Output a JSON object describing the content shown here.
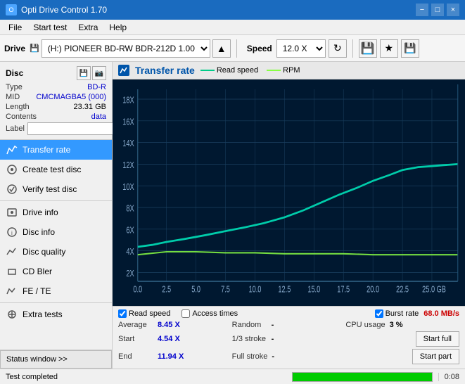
{
  "titleBar": {
    "title": "Opti Drive Control 1.70",
    "minimize": "−",
    "maximize": "□",
    "close": "×"
  },
  "menuBar": {
    "items": [
      "File",
      "Start test",
      "Extra",
      "Help"
    ]
  },
  "toolbar": {
    "driveLabel": "Drive",
    "driveValue": "(H:)  PIONEER BD-RW   BDR-212D 1.00",
    "speedLabel": "Speed",
    "speedValue": "12.0 X"
  },
  "disc": {
    "title": "Disc",
    "typeLabel": "Type",
    "typeValue": "BD-R",
    "midLabel": "MID",
    "midValue": "CMCMAGBA5 (000)",
    "lengthLabel": "Length",
    "lengthValue": "23.31 GB",
    "contentsLabel": "Contents",
    "contentsValue": "data",
    "labelLabel": "Label",
    "labelValue": ""
  },
  "nav": {
    "items": [
      {
        "id": "transfer-rate",
        "label": "Transfer rate",
        "active": true
      },
      {
        "id": "create-test-disc",
        "label": "Create test disc",
        "active": false
      },
      {
        "id": "verify-test-disc",
        "label": "Verify test disc",
        "active": false
      },
      {
        "id": "drive-info",
        "label": "Drive info",
        "active": false
      },
      {
        "id": "disc-info",
        "label": "Disc info",
        "active": false
      },
      {
        "id": "disc-quality",
        "label": "Disc quality",
        "active": false
      },
      {
        "id": "cd-bler",
        "label": "CD Bler",
        "active": false
      },
      {
        "id": "fe-te",
        "label": "FE / TE",
        "active": false
      },
      {
        "id": "extra-tests",
        "label": "Extra tests",
        "active": false
      }
    ]
  },
  "statusWindow": {
    "label": "Status window >>"
  },
  "chart": {
    "title": "Transfer rate",
    "legendReadSpeed": "Read speed",
    "legendRPM": "RPM",
    "readSpeedColor": "#00cc88",
    "rpmColor": "#88ff44",
    "yAxisLabels": [
      "2X",
      "4X",
      "6X",
      "8X",
      "10X",
      "12X",
      "14X",
      "16X",
      "18X"
    ],
    "xAxisLabels": [
      "0.0",
      "2.5",
      "5.0",
      "7.5",
      "10.0",
      "12.5",
      "15.0",
      "17.5",
      "20.0",
      "22.5",
      "25.0 GB"
    ]
  },
  "stats": {
    "readSpeedChecked": true,
    "accessTimesChecked": false,
    "burstRateChecked": true,
    "burstRateValue": "68.0 MB/s",
    "rows": [
      {
        "col1Label": "Average",
        "col1Value": "8.45 X",
        "col2Label": "Random",
        "col2Value": "-",
        "col3Label": "CPU usage",
        "col3Value": "3 %"
      },
      {
        "col1Label": "Start",
        "col1Value": "4.54 X",
        "col2Label": "1/3 stroke",
        "col2Value": "-",
        "col3Label": "",
        "col3Value": "",
        "btn": "Start full"
      },
      {
        "col1Label": "End",
        "col1Value": "11.94 X",
        "col2Label": "Full stroke",
        "col2Value": "-",
        "col3Label": "",
        "col3Value": "",
        "btn": "Start part"
      }
    ]
  },
  "statusBar": {
    "text": "Test completed",
    "progress": 100,
    "time": "0:08"
  }
}
